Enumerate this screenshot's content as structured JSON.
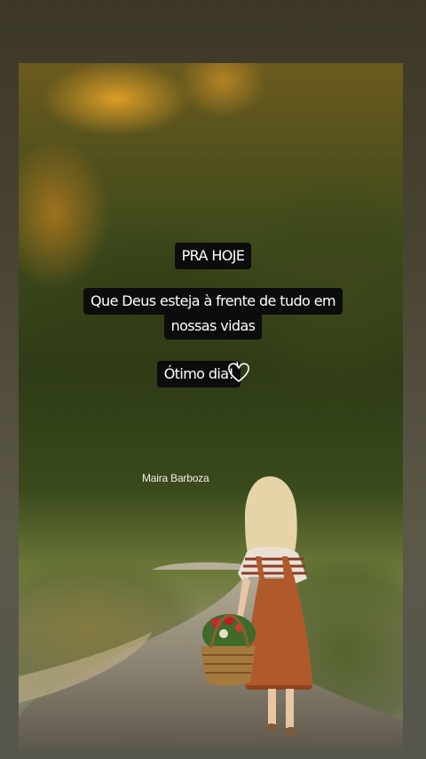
{
  "story": {
    "title_tag": "PRA HOJE",
    "message_line1": "Que Deus esteja à frente de tudo em",
    "message_line2": "nossas vidas",
    "greeting": "Ótimo dia!",
    "credit": "Maira Barboza"
  },
  "icons": {
    "heart": "heart-outline-icon"
  },
  "colors": {
    "tag_background": "#0c0c0c",
    "tag_text": "#ffffff",
    "frame_background": "#4a4433"
  }
}
